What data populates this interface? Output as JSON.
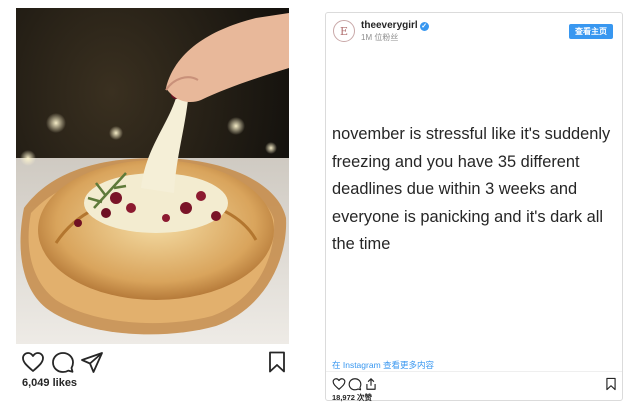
{
  "left_post": {
    "likes": "6,049 likes",
    "photo": "baked brie bread bowl with cranberries",
    "icons": [
      "heart-icon",
      "comment-icon",
      "share-icon",
      "bookmark-icon"
    ]
  },
  "embed": {
    "username": "theeverygirl",
    "avatar_letter": "E",
    "followers": "1M 位粉丝",
    "profile_button": "查看主页",
    "caption": "november is stressful like it's suddenly freezing and you have 35 different deadlines due within 3 weeks and everyone is panicking and it's dark all the time",
    "view_more": "在 Instagram 查看更多内容",
    "likes": "18,972 次赞",
    "icons": [
      "heart-icon",
      "comment-icon",
      "share-icon",
      "bookmark-icon"
    ]
  },
  "colors": {
    "link_blue": "#3897f0",
    "text": "#262626",
    "muted": "#8e8e8e",
    "border": "#dbdbdb"
  }
}
